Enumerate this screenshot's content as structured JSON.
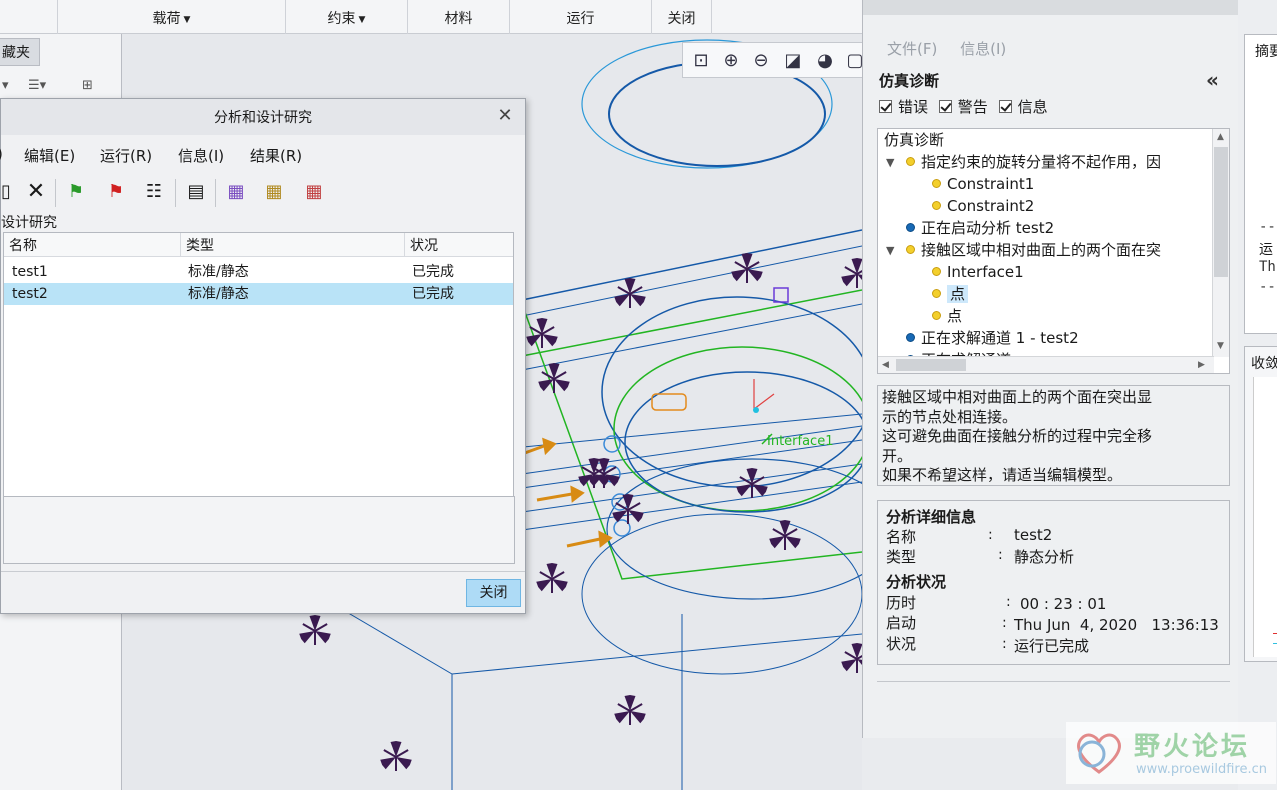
{
  "ribbon": {
    "load": "载荷",
    "constraint": "约束",
    "material": "材料",
    "run": "运行",
    "close": "关闭"
  },
  "left_panel": {
    "favorites_tab": "藏夹"
  },
  "dialog": {
    "title": "分析和设计研究",
    "menu": [
      "编辑(E)",
      "运行(R)",
      "信息(I)",
      "结果(R)"
    ],
    "group_label": "设计研究",
    "columns": [
      "名称",
      "类型",
      "状况"
    ],
    "rows": [
      {
        "name": "test1",
        "type": "标准/静态",
        "status": "已完成"
      },
      {
        "name": "test2",
        "type": "标准/静态",
        "status": "已完成"
      }
    ],
    "close_button": "关闭"
  },
  "diagnostics": {
    "menu": [
      "文件(F)",
      "信息(I)"
    ],
    "title": "仿真诊断",
    "filters": {
      "error": "错误",
      "warning": "警告",
      "info": "信息"
    },
    "tree": {
      "root": "仿真诊断",
      "n1": "指定约束的旋转分量将不起作用，因",
      "n1a": "Constraint1",
      "n1b": "Constraint2",
      "n2": "正在启动分析 test2",
      "n3": "接触区域中相对曲面上的两个面在突",
      "n3a": "Interface1",
      "n3b": "点",
      "n3c": "点",
      "n4": "正在求解通道 1 - test2",
      "n5": "正在求解通道"
    },
    "message": [
      "接触区域中相对曲面上的两个面在突出显",
      "示的节点处相连接。",
      "这可避免曲面在接触分析的过程中完全移",
      "开。",
      "如果不希望这样，请适当编辑模型。"
    ],
    "details": {
      "info_heading": "分析详细信息",
      "name_label": "名称",
      "name_value": "test2",
      "type_label": "类型",
      "type_value": "静态分析",
      "status_heading": "分析状况",
      "elapsed_label": "历时",
      "elapsed_value": "00 : 23 : 01",
      "start_label": "启动",
      "start_value": "Thu Jun  4, 2020   13:36:13",
      "state_label": "状况",
      "state_value": "运行已完成",
      "colon": ":"
    }
  },
  "far_right": {
    "summary_title": "摘要",
    "dash1": "--",
    "run": "运",
    "thu": "Th",
    "dash2": "--",
    "convergence_title": "收敛"
  },
  "viewport": {
    "label": "Interface1"
  },
  "watermark": {
    "title": "野火论坛",
    "url": "www.proewildfire.cn"
  },
  "colors": {
    "accent": "#aedbf6",
    "selection": "#b9e3f7",
    "model_green": "#22b522",
    "model_blue": "#1559a8",
    "glyph": "#3a1a50"
  }
}
